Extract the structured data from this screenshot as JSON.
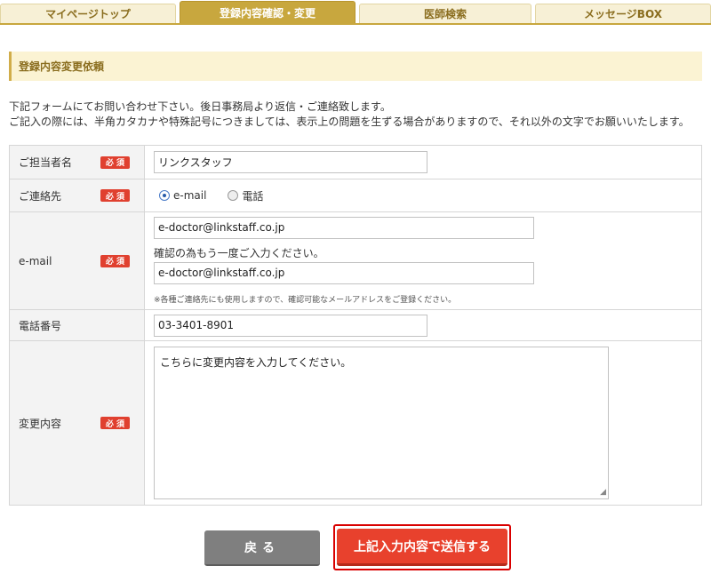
{
  "tabs": [
    {
      "label": "マイページトップ",
      "active": false
    },
    {
      "label": "登録内容確認・変更",
      "active": true
    },
    {
      "label": "医師検索",
      "active": false
    },
    {
      "label": "メッセージBOX",
      "active": false
    }
  ],
  "section_title": "登録内容変更依頼",
  "intro": {
    "line1": "下記フォームにてお問い合わせ下さい。後日事務局より返信・ご連絡致します。",
    "line2": "ご記入の際には、半角カタカナや特殊記号につきましては、表示上の問題を生ずる場合がありますので、それ以外の文字でお願いいたします。"
  },
  "required_label": "必 須",
  "form": {
    "contact_person": {
      "label": "ご担当者名",
      "value": "リンクスタッフ"
    },
    "contact_method": {
      "label": "ご連絡先",
      "options": [
        "e-mail",
        "電話"
      ],
      "selected": "e-mail"
    },
    "email": {
      "label": "e-mail",
      "value": "e-doctor@linkstaff.co.jp",
      "confirm_label": "確認の為もう一度ご入力ください。",
      "confirm_value": "e-doctor@linkstaff.co.jp",
      "note": "※各種ご連絡先にも使用しますので、確認可能なメールアドレスをご登録ください。"
    },
    "phone": {
      "label": "電話番号",
      "value": "03-3401-8901"
    },
    "changes": {
      "label": "変更内容",
      "placeholder": "こちらに変更内容を入力してください。"
    }
  },
  "buttons": {
    "back": "戻る",
    "submit": "上記入力内容で送信する"
  },
  "colors": {
    "accent": "#c8a73e",
    "required": "#e0402f",
    "submit": "#e8412d",
    "back": "#7f7f7f"
  }
}
